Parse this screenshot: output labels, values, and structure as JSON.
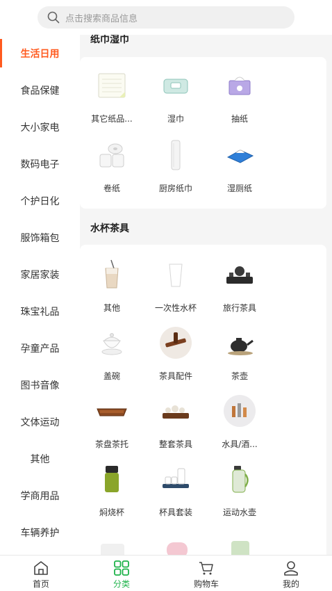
{
  "search": {
    "placeholder": "点击搜索商品信息"
  },
  "sidebar": {
    "items": [
      {
        "label": "生活日用",
        "active": true
      },
      {
        "label": "食品保健"
      },
      {
        "label": "大小家电"
      },
      {
        "label": "数码电子"
      },
      {
        "label": "个护日化"
      },
      {
        "label": "服饰箱包"
      },
      {
        "label": "家居家装"
      },
      {
        "label": "珠宝礼品"
      },
      {
        "label": "孕童产品"
      },
      {
        "label": "图书音像"
      },
      {
        "label": "文体运动"
      },
      {
        "label": "其他"
      },
      {
        "label": "学商用品"
      },
      {
        "label": "车辆养护"
      }
    ]
  },
  "sections": [
    {
      "title": "纸巾湿巾",
      "items": [
        {
          "label": "其它纸品...",
          "icon": "paper-pad-icon"
        },
        {
          "label": "湿巾",
          "icon": "wet-wipes-icon"
        },
        {
          "label": "抽纸",
          "icon": "tissue-box-icon"
        },
        {
          "label": "卷纸",
          "icon": "toilet-roll-icon"
        },
        {
          "label": "厨房纸巾",
          "icon": "kitchen-roll-icon"
        },
        {
          "label": "湿厕纸",
          "icon": "wet-toilet-paper-icon"
        }
      ]
    },
    {
      "title": "水杯茶具",
      "items": [
        {
          "label": "其他",
          "icon": "glass-cup-icon"
        },
        {
          "label": "一次性水杯",
          "icon": "paper-cup-icon"
        },
        {
          "label": "旅行茶具",
          "icon": "travel-tea-set-icon"
        },
        {
          "label": "盖碗",
          "icon": "lidded-bowl-icon"
        },
        {
          "label": "茶具配件",
          "icon": "tea-accessory-icon"
        },
        {
          "label": "茶壶",
          "icon": "teapot-icon"
        },
        {
          "label": "茶盘茶托",
          "icon": "tea-tray-icon"
        },
        {
          "label": "整套茶具",
          "icon": "full-tea-set-icon"
        },
        {
          "label": "水具/酒...",
          "icon": "drinkware-set-icon"
        },
        {
          "label": "焖烧杯",
          "icon": "thermal-jar-icon"
        },
        {
          "label": "杯具套装",
          "icon": "cup-set-icon"
        },
        {
          "label": "运动水壶",
          "icon": "sports-bottle-icon"
        }
      ]
    }
  ],
  "tabs": [
    {
      "label": "首页",
      "icon": "home-icon"
    },
    {
      "label": "分类",
      "icon": "category-grid-icon",
      "active": true
    },
    {
      "label": "购物车",
      "icon": "cart-icon"
    },
    {
      "label": "我的",
      "icon": "user-icon"
    }
  ],
  "colors": {
    "accent": "#ff5a1f",
    "active_tab": "#1eb34a",
    "background": "#f5f5f5"
  }
}
